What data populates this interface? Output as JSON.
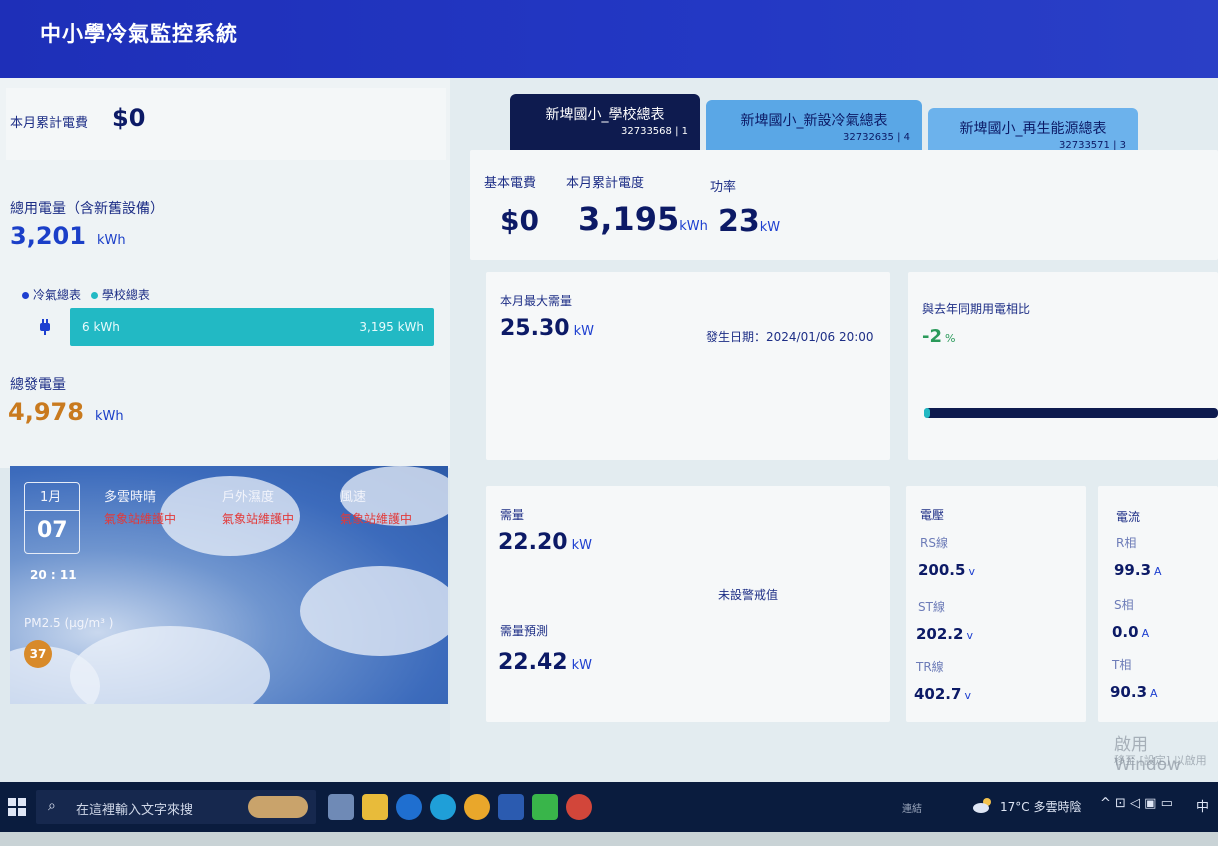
{
  "header": {
    "title": "中小學冷氣監控系統"
  },
  "left": {
    "monthly_fee_label": "本月累計電費",
    "monthly_fee_value": "$0",
    "total_usage_label": "總用電量（含新舊設備）",
    "total_usage_value": "3,201",
    "total_usage_unit": "kWh",
    "legend_ac": "冷氣總表",
    "legend_school": "學校總表",
    "bar_left": "6 kWh",
    "bar_right": "3,195 kWh",
    "gen_label": "總發電量",
    "gen_value": "4,978",
    "gen_unit": "kWh"
  },
  "weather": {
    "month": "1月",
    "day": "07",
    "time": "20 : 11",
    "cond_label": "多雲時晴",
    "cond_status": "氣象站維護中",
    "humid_label": "戶外濕度",
    "humid_status": "氣象站維護中",
    "wind_label": "風速",
    "wind_status": "氣象站維護中",
    "pm_label": "PM2.5 (μg/m³ )",
    "pm_value": "37"
  },
  "tabs": [
    {
      "name": "新埤國小_學校總表",
      "code": "32733568 | 1"
    },
    {
      "name": "新埤國小_新設冷氣總表",
      "code": "32732635 | 4"
    },
    {
      "name": "新埤國小_再生能源總表",
      "code": "32733571 | 3"
    }
  ],
  "summary": {
    "base_fee_label": "基本電費",
    "base_fee_value": "$0",
    "month_kwh_label": "本月累計電度",
    "month_kwh_value": "3,195",
    "month_kwh_unit": "kWh",
    "power_label": "功率",
    "power_value": "23",
    "power_unit": "kW"
  },
  "maxdemand": {
    "label": "本月最大需量",
    "value": "25.30",
    "unit": "kW",
    "date": "發生日期：2024/01/06 20:00"
  },
  "compare": {
    "label": "與去年同期用電相比",
    "value": "-2",
    "unit": "%",
    "progress": 0.02
  },
  "demand": {
    "label": "需量",
    "value": "22.20",
    "unit": "kW",
    "warn": "未設警戒值",
    "forecast_label": "需量預測",
    "forecast_value": "22.42",
    "forecast_unit": "kW"
  },
  "voltage": {
    "title": "電壓",
    "rs_label": "RS線",
    "rs": "200.5",
    "st_label": "ST線",
    "st": "202.2",
    "tr_label": "TR線",
    "tr": "402.7",
    "unit": "v"
  },
  "current": {
    "title": "電流",
    "r_label": "R相",
    "r": "99.3",
    "s_label": "S相",
    "s": "0.0",
    "t_label": "T相",
    "t": "90.3",
    "unit": "A"
  },
  "watermark": {
    "line1": "啟用 Window",
    "line2": "移至 [設定] 以啟用"
  },
  "taskbar": {
    "search_placeholder": "在這裡輸入文字來搜",
    "weather": "17°C 多雲時陰",
    "ime": "中",
    "tray_text": "連結"
  },
  "colors": {
    "header": "#2338c4",
    "teal": "#22b9c4",
    "orange": "#d88a2a",
    "dark": "#0c1a66"
  }
}
